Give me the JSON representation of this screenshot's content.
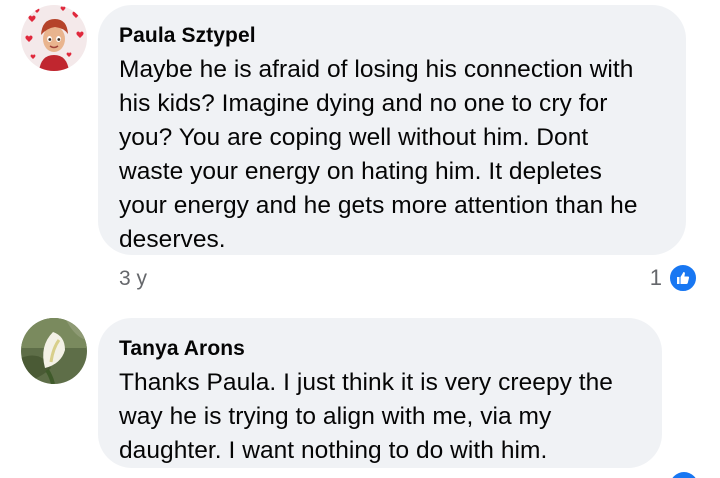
{
  "comments": [
    {
      "author": "Paula Sztypel",
      "lines": [
        "Maybe he is afraid of losing his connection with",
        "his kids? Imagine dying and no one to cry for",
        "you? You are coping well without him. Dont",
        "waste your energy on hating him. It depletes",
        "your energy and he gets more attention than he",
        "deserves."
      ],
      "time": "3 y",
      "reaction_count": "1",
      "reaction_icon": "thumbs-up-icon",
      "avatar_icon": "cartoon-avatar-with-hearts"
    },
    {
      "author": "Tanya Arons",
      "lines": [
        "Thanks Paula.  I just think it is very creepy the",
        "way he is trying to align with me, via my",
        "daughter.  I want nothing to do with him."
      ],
      "avatar_icon": "calla-lily-photo"
    }
  ],
  "colors": {
    "bubble": "#f0f2f5",
    "meta_text": "#65676b",
    "like_blue": "#1877f2"
  }
}
